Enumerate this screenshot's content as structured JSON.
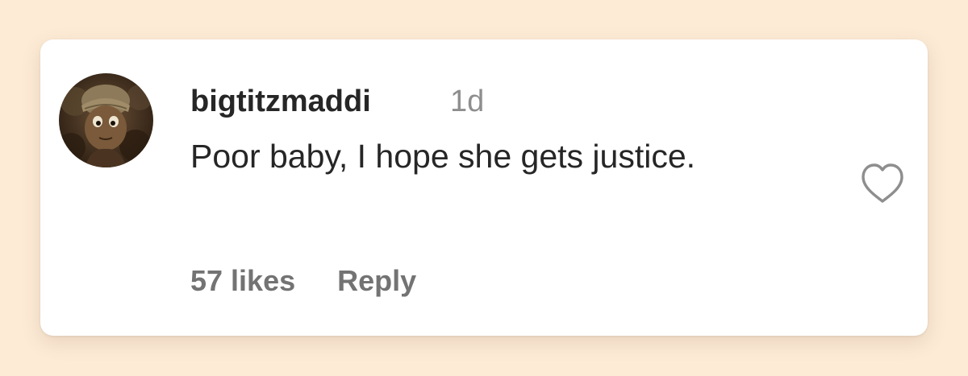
{
  "comment": {
    "username": "bigtitzmaddi",
    "timestamp": "1d",
    "text": "Poor baby, I hope she gets justice.",
    "likes_label": "57 likes",
    "reply_label": "Reply"
  },
  "colors": {
    "background": "#fdebd6",
    "card": "#ffffff",
    "primary_text": "#262626",
    "secondary_text": "#737373",
    "timestamp_text": "#8e8e8e"
  },
  "icons": {
    "like": "heart-outline-icon",
    "avatar": "profile-avatar"
  }
}
